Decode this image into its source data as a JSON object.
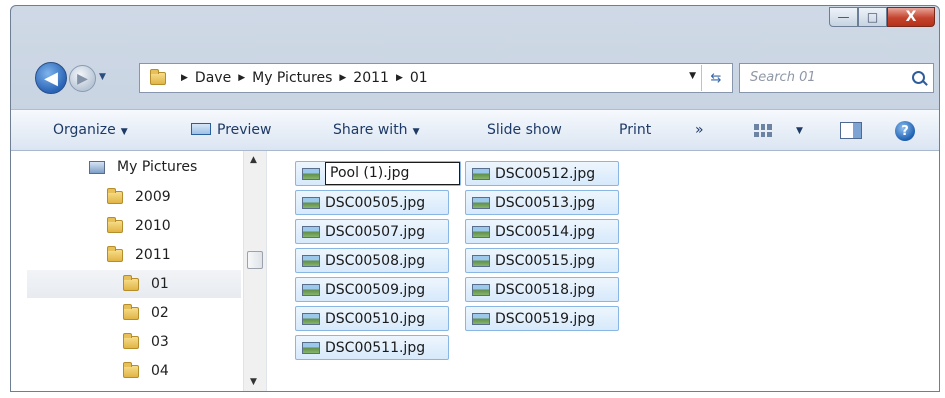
{
  "window": {
    "caption_buttons": {
      "minimize": "—",
      "maximize": "□",
      "close": "X"
    }
  },
  "nav": {
    "back_glyph": "◀",
    "forward_glyph": "▶",
    "breadcrumbs": [
      "Dave",
      "My Pictures",
      "2011",
      "01"
    ],
    "search_placeholder": "Search 01"
  },
  "toolbar": {
    "organize": "Organize",
    "preview": "Preview",
    "share_with": "Share with",
    "slide_show": "Slide show",
    "print": "Print",
    "more": "»"
  },
  "tree": {
    "items": [
      {
        "label": "My Pictures",
        "selected": false
      },
      {
        "label": "2009",
        "selected": false
      },
      {
        "label": "2010",
        "selected": false
      },
      {
        "label": "2011",
        "selected": false
      },
      {
        "label": "01",
        "selected": true
      },
      {
        "label": "02",
        "selected": false
      },
      {
        "label": "03",
        "selected": false
      },
      {
        "label": "04",
        "selected": false
      }
    ]
  },
  "files": {
    "column1": [
      "Pool (1).jpg",
      "DSC00505.jpg",
      "DSC00507.jpg",
      "DSC00508.jpg",
      "DSC00509.jpg",
      "DSC00510.jpg",
      "DSC00511.jpg"
    ],
    "column2": [
      "DSC00512.jpg",
      "DSC00513.jpg",
      "DSC00514.jpg",
      "DSC00515.jpg",
      "DSC00518.jpg",
      "DSC00519.jpg"
    ],
    "renaming": "Pool (1).jpg"
  }
}
